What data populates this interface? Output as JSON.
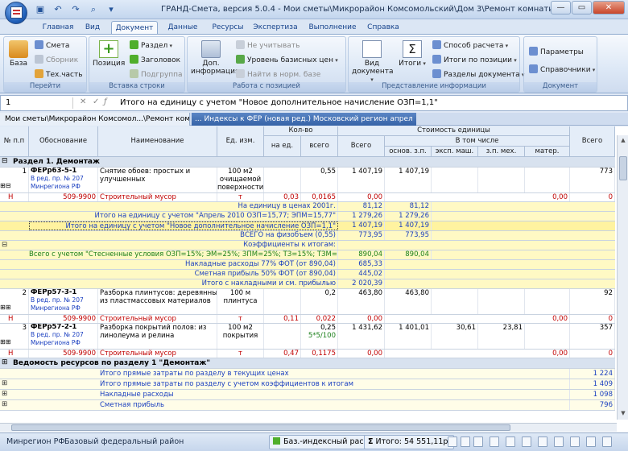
{
  "app": {
    "title": "ГРАНД-Смета, версия 5.0.4 - Мои сметы\\Микрорайон Комсомольский\\Дом 3\\Ремонт комнаты"
  },
  "tabs": [
    "Главная",
    "Вид",
    "Документ",
    "Данные",
    "Ресурсы",
    "Экспертиза",
    "Выполнение",
    "Справка"
  ],
  "ribbon": {
    "g1": {
      "label": "Перейти",
      "baza": "База",
      "smeta": "Смета",
      "sbornik": "Сборник",
      "tehchast": "Тех.часть"
    },
    "g2": {
      "label": "Вставка строки",
      "pozicia": "Позиция",
      "razdel": "Раздел",
      "zagolovok": "Заголовок",
      "podgruppa": "Подгруппа"
    },
    "g3": {
      "label": "Работа с позицией",
      "dop1": "Доп.",
      "dop2": "информация",
      "ne_uchit": "Не учитывать",
      "uroven": "Уровень базисных цен",
      "nayti": "Найти в норм. базе"
    },
    "g4": {
      "label": "Представление информации",
      "vid1": "Вид",
      "vid2": "документа",
      "itogi": "Итоги",
      "sposob": "Способ расчета",
      "itogi_poz": "Итоги по позиции",
      "razdely": "Разделы документа"
    },
    "g5": {
      "label": "Документ",
      "params": "Параметры",
      "spravochniki": "Справочники"
    }
  },
  "formula": {
    "cell": "1",
    "text": "Итого на единицу с учетом \"Новое дополнительное начисление ОЗП=1,1\""
  },
  "breadcrumb": {
    "path": "Мои сметы\\Микрорайон Комсомол...\\Ремонт комнаты",
    "tab": "... Индексы к ФЕР (новая ред.) Московский регион апрел"
  },
  "headers": {
    "num": "№ п.п",
    "obosn": "Обоснование",
    "naim": "Наименование",
    "ed": "Ед. изм.",
    "kolvo": "Кол-во",
    "na_ed": "на ед.",
    "vsego": "всего",
    "stoim": "Стоимость единицы",
    "vsego2": "Всего",
    "vtom": "В том числе",
    "osn": "основ. з.п.",
    "eksp": "эксп. маш.",
    "zp_meh": "з.п. мех.",
    "mater": "матер.",
    "vsego3": "Всего"
  },
  "rows": {
    "sec1": "Раздел 1. Демонтаж",
    "p1": {
      "n": "1",
      "code": "ФЕРр63-5-1",
      "red": "В ред. пр. № 207",
      "min": "Минрегиона РФ",
      "name1": "Снятие обоев: простых и",
      "name2": "улучшенных",
      "ed1": "100 м2",
      "ed2": "очищаемой",
      "ed3": "поверхности",
      "vsego": "0,55",
      "price": "1 407,19",
      "osn": "1 407,19",
      "total": "773"
    },
    "p1h": {
      "n": "Н",
      "code": "509-9900",
      "name": "Строительный мусор",
      "ed": "т",
      "na_ed": "0,03",
      "vsego": "0,0165",
      "price": "0,00",
      "mater": "0,00",
      "total": "0"
    },
    "s1": {
      "label": "На единицу в ценах 2001г.",
      "a": "81,12",
      "b": "81,12"
    },
    "s2": {
      "label": "Итого на единицу с учетом \"Апрель 2010 ОЗП=15,77; ЭПМ=15,77\"",
      "a": "1 279,26",
      "b": "1 279,26"
    },
    "s3": {
      "label": "Итого на единицу с учетом \"Новое дополнительное начисление ОЗП=1,1\"",
      "a": "1 407,19",
      "b": "1 407,19"
    },
    "s4": {
      "label": "ВСЕГО на физобъем (0,55)",
      "a": "773,95",
      "b": "773,95"
    },
    "s5": {
      "label": "Коэффициенты к итогам:"
    },
    "s6": {
      "label": "Всего с учетом \"Стесненные условия ОЗП=15%; ЭМ=25%; ЗПМ=25%; ТЗ=15%; ТЗМ=25%\"",
      "a": "890,04",
      "b": "890,04"
    },
    "s7": {
      "label": "Накладные расходы 77% ФОТ (от 890,04)",
      "a": "685,33"
    },
    "s8": {
      "label": "Сметная прибыль 50% ФОТ (от 890,04)",
      "a": "445,02"
    },
    "s9": {
      "label": "Итого с накладными и см. прибылью",
      "a": "2 020,39"
    },
    "p2": {
      "n": "2",
      "code": "ФЕРр57-3-1",
      "red": "В ред. пр. № 207",
      "min": "Минрегиона РФ",
      "name1": "Разборка плинтусов: деревянных и",
      "name2": "из пластмассовых материалов",
      "ed1": "100 м",
      "ed2": "плинтуса",
      "vsego": "0,2",
      "price": "463,80",
      "osn": "463,80",
      "total": "92"
    },
    "p2h": {
      "n": "Н",
      "code": "509-9900",
      "name": "Строительный мусор",
      "ed": "т",
      "na_ed": "0,11",
      "vsego": "0,022",
      "price": "0,00",
      "mater": "0,00",
      "total": "0"
    },
    "p3": {
      "n": "3",
      "code": "ФЕРр57-2-1",
      "red": "В ред. пр. № 207",
      "min": "Минрегиона РФ",
      "name1": "Разборка покрытий полов: из",
      "name2": "линолеума и релина",
      "ed1": "100 м2",
      "ed2": "покрытия",
      "vsego": "0,25",
      "formula": "5*5/100",
      "price": "1 431,62",
      "osn": "1 401,01",
      "eksp": "30,61",
      "zpm": "23,81",
      "total": "357"
    },
    "p3h": {
      "n": "Н",
      "code": "509-9900",
      "name": "Строительный мусор",
      "ed": "т",
      "na_ed": "0,47",
      "vsego": "0,1175",
      "price": "0,00",
      "mater": "0,00",
      "total": "0"
    },
    "ved": "Ведомость ресурсов по разделу 1 \"Демонтаж\"",
    "t1": {
      "label": "Итого прямые затраты по разделу в текущих ценах",
      "v": "1 224"
    },
    "t2": {
      "label": "Итого прямые затраты по разделу с учетом коэффициентов к итогам",
      "v": "1 409"
    },
    "t3": {
      "label": "Накладные расходы",
      "v": "1 098"
    },
    "t4": {
      "label": "Сметная прибыль",
      "v": "796"
    }
  },
  "status": {
    "region": "Минрегион РФ",
    "base": "Базовый федеральный район",
    "calc": "Баз.-индексный расчет",
    "sum_icon": "Σ",
    "total": "Итого: 54 551,11р."
  },
  "colors": {
    "accent": "#15428b",
    "link_green": "#1a7f1a",
    "blue_text": "#1a3fc0",
    "red_text": "#c00000",
    "highlight": "#fff9c4"
  }
}
